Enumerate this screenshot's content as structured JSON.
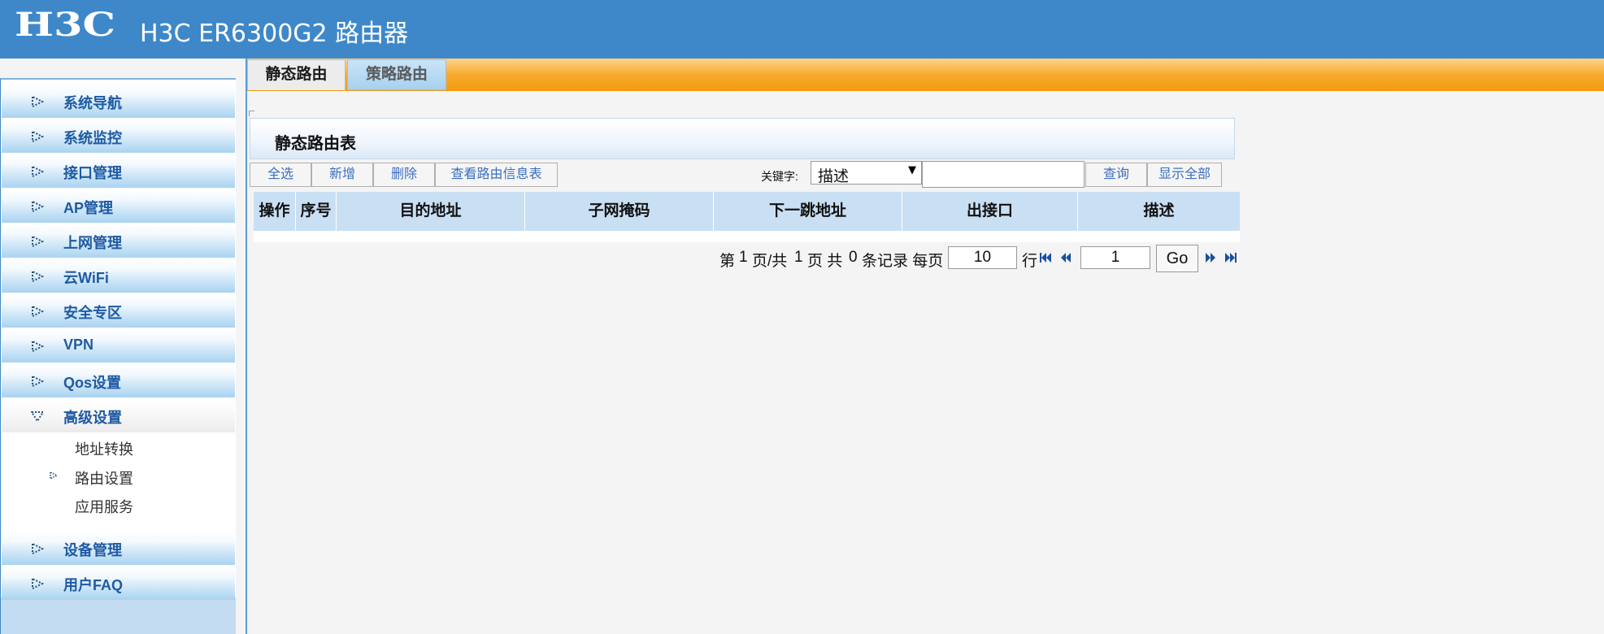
{
  "header": {
    "logo_text": "H3C",
    "title": "H3C ER6300G2 路由器"
  },
  "sidebar": {
    "items": [
      {
        "label": "系统导航",
        "icon": "arrow-right-icon"
      },
      {
        "label": "系统监控",
        "icon": "arrow-right-icon"
      },
      {
        "label": "接口管理",
        "icon": "arrow-right-icon"
      },
      {
        "label": "AP管理",
        "icon": "arrow-right-icon"
      },
      {
        "label": "上网管理",
        "icon": "arrow-right-icon"
      },
      {
        "label": "云WiFi",
        "icon": "arrow-right-icon"
      },
      {
        "label": "安全专区",
        "icon": "arrow-right-icon"
      },
      {
        "label": "VPN",
        "icon": "arrow-right-icon"
      },
      {
        "label": "Qos设置",
        "icon": "arrow-right-icon"
      },
      {
        "label": "高级设置",
        "icon": "arrow-down-icon",
        "expanded": true
      },
      {
        "label": "设备管理",
        "icon": "arrow-right-icon"
      },
      {
        "label": "用户FAQ",
        "icon": "arrow-right-icon"
      }
    ],
    "subitems": [
      {
        "label": "地址转换"
      },
      {
        "label": "路由设置",
        "selected": true
      },
      {
        "label": "应用服务"
      }
    ]
  },
  "tabs": [
    {
      "label": "静态路由",
      "active": true
    },
    {
      "label": "策略路由",
      "active": false
    }
  ],
  "panel": {
    "title": "静态路由表"
  },
  "toolbar": {
    "select_all": "全选",
    "add": "新增",
    "delete": "删除",
    "view_route_info": "查看路由信息表",
    "keyword_label": "关键字:",
    "keyword_selected": "描述",
    "keyword_value": "",
    "query": "查询",
    "show_all": "显示全部"
  },
  "table": {
    "columns": [
      "操作",
      "序号",
      "目的地址",
      "子网掩码",
      "下一跳地址",
      "出接口",
      "描述"
    ],
    "rows": []
  },
  "pagination": {
    "page_prefix": "第",
    "current_page": "1",
    "page_mid": "页/共",
    "total_pages": "1",
    "total_mid": "页 共",
    "record_count": "0",
    "record_suffix": "条记录 每页",
    "per_page": "10",
    "per_page_suffix": "行",
    "jump_page": "1",
    "go": "Go"
  },
  "colors": {
    "header_bg": "#3e88c9",
    "tab_bar_orange": "#f7ab2f",
    "menu_text": "#1f5aa3",
    "link_blue": "#3b6fc1"
  }
}
